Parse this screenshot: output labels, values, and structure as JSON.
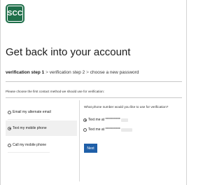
{
  "app": {
    "logo_text": "SCC"
  },
  "header": {
    "title": "Get back into your account"
  },
  "breadcrumb": {
    "step1": "verification step 1",
    "separator": " > ",
    "step2": "verification step 2",
    "step3": "choose a new password"
  },
  "instruction": "Please choose the first contact method we should use for verification:",
  "methods": [
    {
      "label": "Email my alternate email",
      "selected": false
    },
    {
      "label": "Text my mobile phone",
      "selected": true
    },
    {
      "label": "Call my mobile phone",
      "selected": false
    }
  ],
  "phone_panel": {
    "question": "What phone number would you like to use for verification?",
    "options": [
      {
        "label": "Text me at ***********",
        "checked": true
      },
      {
        "label": "Text me at ***********",
        "checked": false
      }
    ],
    "next_label": "Next"
  },
  "colors": {
    "brand": "#1f6f4a",
    "button": "#1f5fa8",
    "selected_bg": "#f0f0f0"
  }
}
